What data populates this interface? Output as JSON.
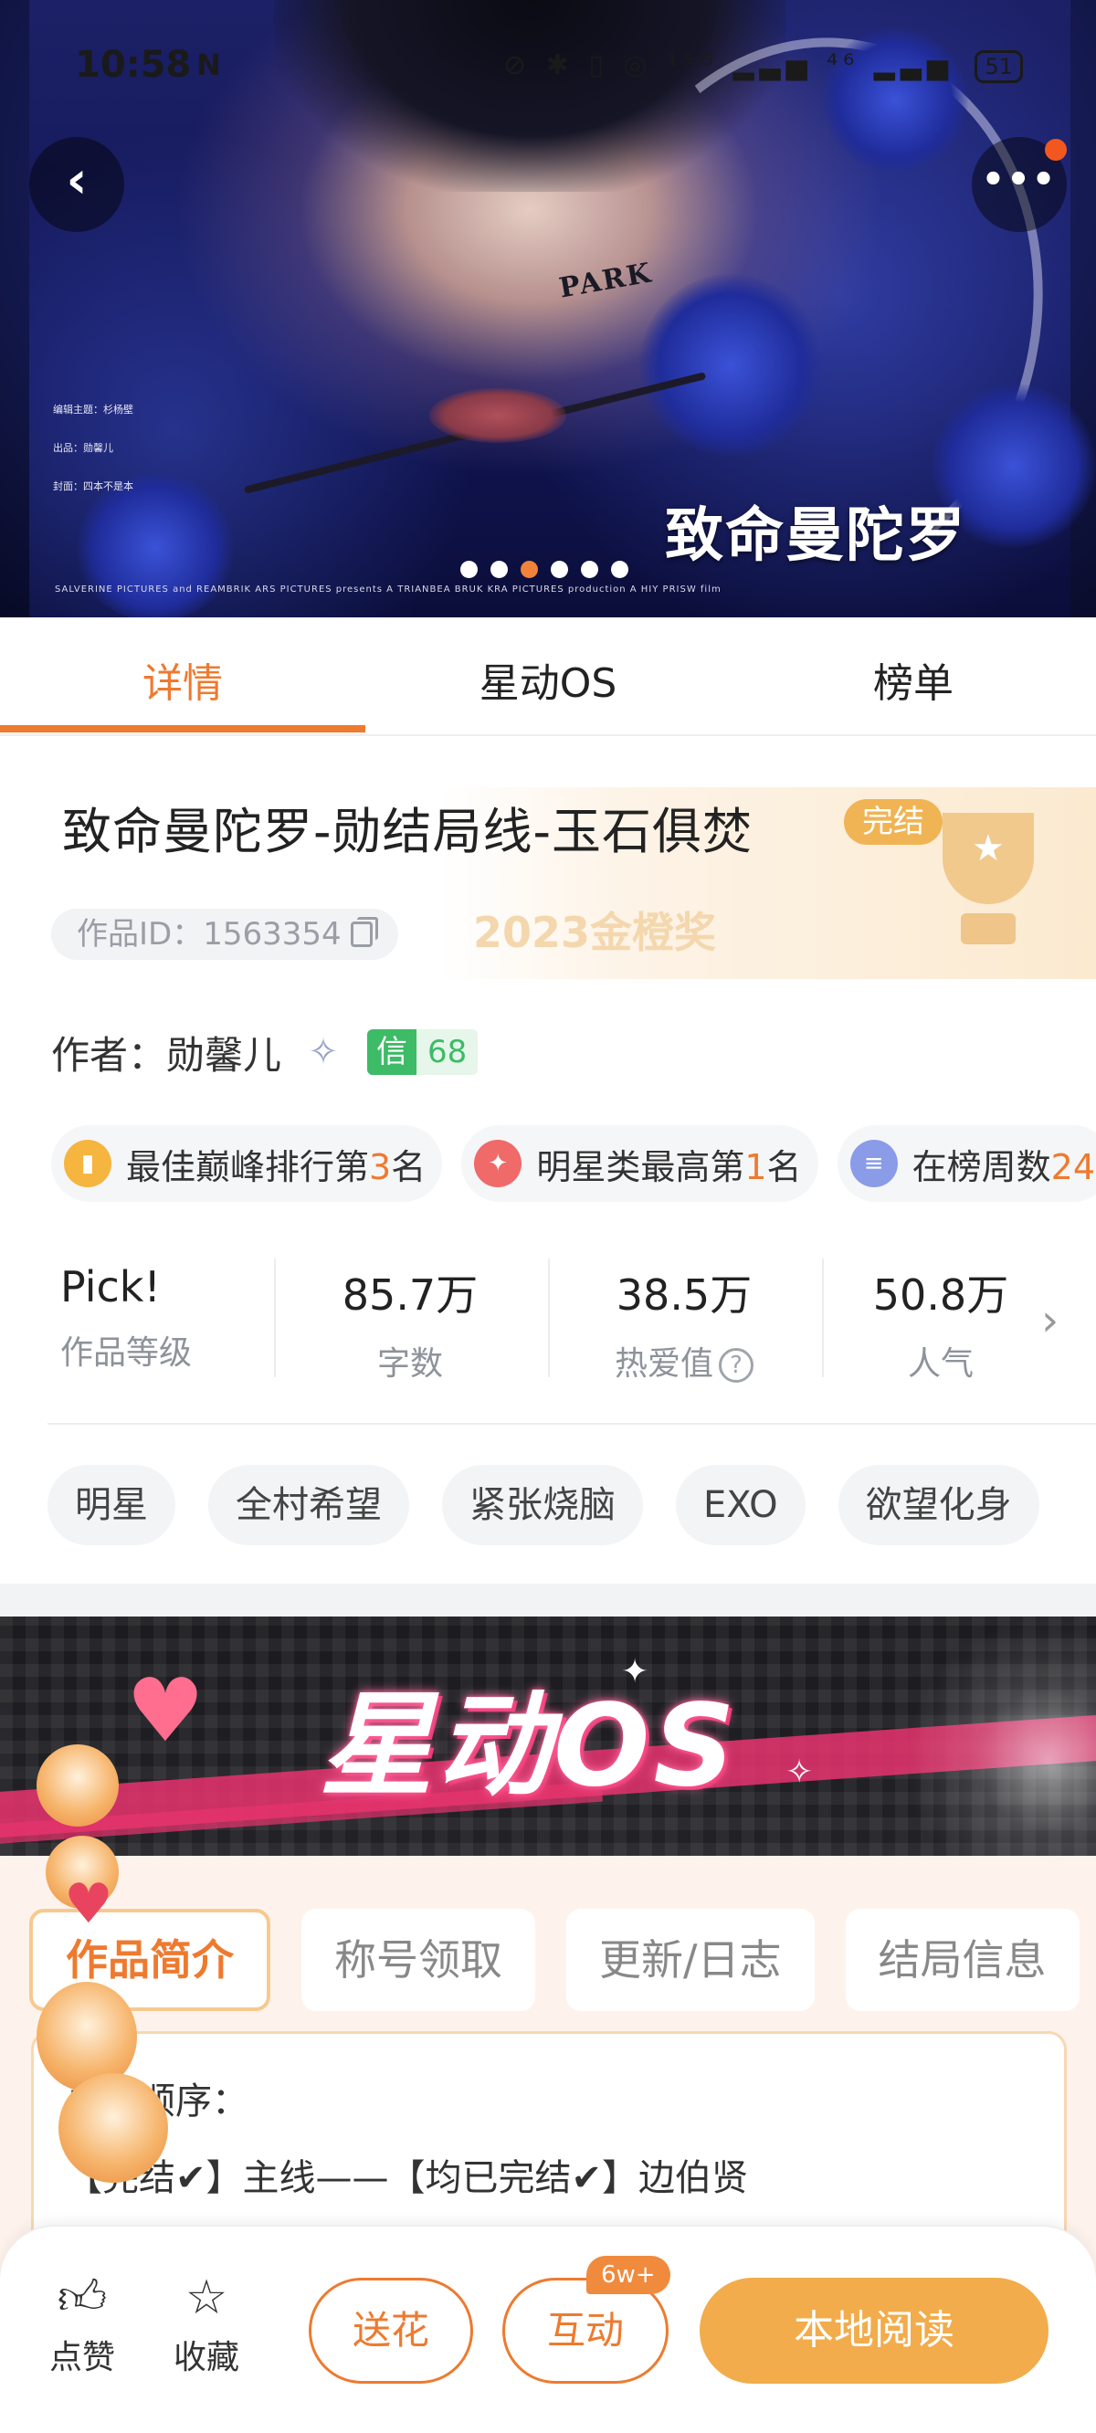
{
  "status_bar": {
    "time": "10:58",
    "nfc": "N",
    "icons": "⊘ ✱ ▯ ◎ ¹⁵ᴳ ▂▃▅ ⁴⁶ ▂▃▅",
    "battery": "51"
  },
  "hero": {
    "poster_text": "PARK",
    "title_art": "致命曼陀罗",
    "credits": [
      "编辑主题：杉杨壁",
      "出品：勋馨儿",
      "封面：四本不是本"
    ],
    "credits_bottom": "SALVERINE PICTURES and REAMBRIK ARS PICTURES presents A TRIANBEA BRUK KRA PICTURES production A HIY PRISW film",
    "carousel_count": 6,
    "carousel_active": 2
  },
  "tabs": [
    {
      "label": "详情",
      "active": true
    },
    {
      "label": "星动OS",
      "active": false
    },
    {
      "label": "榜单",
      "active": false
    }
  ],
  "book": {
    "title": "致命曼陀罗-勋结局线-玉石俱焚",
    "status": "完结",
    "work_id": "作品ID：1563354",
    "award": "2023金橙奖"
  },
  "author": {
    "label": "作者：勋馨儿",
    "credit_label": "信",
    "credit_value": "68"
  },
  "rankings": [
    {
      "pre": "最佳巅峰排行第",
      "hl": "3",
      "post": "名",
      "icon": "bar-chart-icon",
      "color": "#f5b53f"
    },
    {
      "pre": "明星类最高第",
      "hl": "1",
      "post": "名",
      "icon": "badge-icon",
      "color": "#f06a6a"
    },
    {
      "pre": "在榜周数",
      "hl": "24",
      "post": "",
      "icon": "list-icon",
      "color": "#8a9be8"
    }
  ],
  "stats": [
    {
      "value": "Pick!",
      "label": "作品等级"
    },
    {
      "value": "85.7万",
      "label": "字数"
    },
    {
      "value": "38.5万",
      "label": "热爱值"
    },
    {
      "value": "50.8万",
      "label": "人气"
    }
  ],
  "tags": [
    "明星",
    "全村希望",
    "紧张烧脑",
    "EXO",
    "欲望化身"
  ],
  "os_banner": {
    "title": "星动OS"
  },
  "os_tabs": [
    {
      "label": "作品简介",
      "active": true
    },
    {
      "label": "称号领取",
      "active": false
    },
    {
      "label": "更新/日志",
      "active": false
    },
    {
      "label": "结局信息",
      "active": false
    }
  ],
  "intro": {
    "label": "更新顺序：",
    "line": "【完结✔】主线——【均已完结✔】边伯贤"
  },
  "bottom_bar": {
    "like": "点赞",
    "favorite": "收藏",
    "gift": "送花",
    "interact": "互动",
    "interact_badge": "6w+",
    "read": "本地阅读"
  },
  "colors": {
    "accent": "#ee7a2f",
    "read_button": "#f2ac4b",
    "status_badge": "#f0b455",
    "credit_green": "#3dbb66"
  }
}
